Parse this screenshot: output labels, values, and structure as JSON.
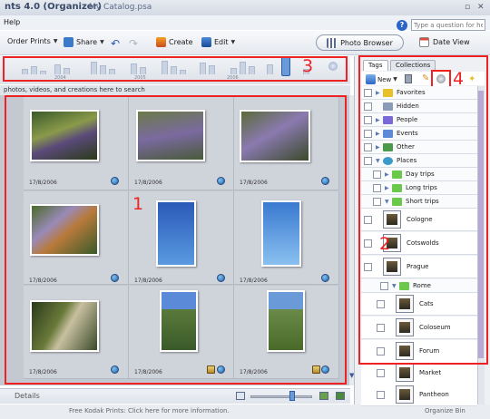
{
  "titlebar": {
    "app_title": "nts 4.0 (Organizer)",
    "catalog": "My Catalog.psa"
  },
  "menubar": {
    "help": "Help",
    "help_search_placeholder": "Type a question for help"
  },
  "toolbar": {
    "order_prints": "Order Prints",
    "share": "Share",
    "create": "Create",
    "edit": "Edit",
    "photo_browser": "Photo Browser",
    "date_view": "Date View"
  },
  "timeline": {
    "years": [
      "2004",
      "2005",
      "2006"
    ]
  },
  "search_hint": "photos, videos, and creations here to search",
  "photos": [
    {
      "date": "17/8/2006",
      "subject": "butterfly-on-lavender"
    },
    {
      "date": "17/8/2006",
      "subject": "lavender-field"
    },
    {
      "date": "17/8/2006",
      "subject": "butterfly-closeup"
    },
    {
      "date": "17/8/2006",
      "subject": "butterfly-on-flower"
    },
    {
      "date": "17/8/2006",
      "subject": "red-flowers-blue-sky"
    },
    {
      "date": "17/8/2006",
      "subject": "red-flower-blue-sky"
    },
    {
      "date": "17/8/2006",
      "subject": "garden-path"
    },
    {
      "date": "17/8/2006",
      "subject": "person-in-garden"
    },
    {
      "date": "17/8/2006",
      "subject": "person-on-lawn"
    }
  ],
  "statusbar": {
    "details": "Details",
    "bottom_hint": "Free Kodak Prints: Click here for more information.",
    "organize_bin": "Organize Bin"
  },
  "tags_panel": {
    "tab_tags": "Tags",
    "tab_collections": "Collections",
    "new_button": "New",
    "rows": [
      {
        "label": "Favorites",
        "icon": "star-icon",
        "color": "#e8c02a"
      },
      {
        "label": "Hidden",
        "icon": "hidden-icon",
        "color": "#8a9bb8"
      },
      {
        "label": "People",
        "icon": "people-icon",
        "color": "#7a6ad8"
      },
      {
        "label": "Events",
        "icon": "events-icon",
        "color": "#5a8ad8"
      },
      {
        "label": "Other",
        "icon": "other-icon",
        "color": "#4a9a4a"
      },
      {
        "label": "Places",
        "icon": "places-icon",
        "color": "#3a9ac8"
      },
      {
        "label": "Day trips",
        "icon": "folder-icon",
        "color": "#6ac84a"
      },
      {
        "label": "Long trips",
        "icon": "folder-icon",
        "color": "#6ac84a"
      },
      {
        "label": "Short trips",
        "icon": "folder-icon",
        "color": "#6ac84a"
      },
      {
        "label": "Cologne",
        "icon": "tag-thumbnail",
        "color": ""
      },
      {
        "label": "Cotswolds",
        "icon": "tag-thumbnail",
        "color": ""
      },
      {
        "label": "Prague",
        "icon": "tag-thumbnail",
        "color": ""
      },
      {
        "label": "Rome",
        "icon": "folder-icon",
        "color": "#6ac84a"
      },
      {
        "label": "Cats",
        "icon": "tag-thumbnail",
        "color": ""
      },
      {
        "label": "Coloseum",
        "icon": "tag-thumbnail",
        "color": ""
      },
      {
        "label": "Forum",
        "icon": "tag-thumbnail",
        "color": ""
      },
      {
        "label": "Market",
        "icon": "tag-thumbnail",
        "color": ""
      },
      {
        "label": "Pantheon",
        "icon": "tag-thumbnail",
        "color": ""
      }
    ]
  },
  "callouts": [
    "1",
    "2",
    "3",
    "4"
  ],
  "colors": {
    "callout_red": "#e22",
    "accent_blue": "#2a64c8"
  }
}
